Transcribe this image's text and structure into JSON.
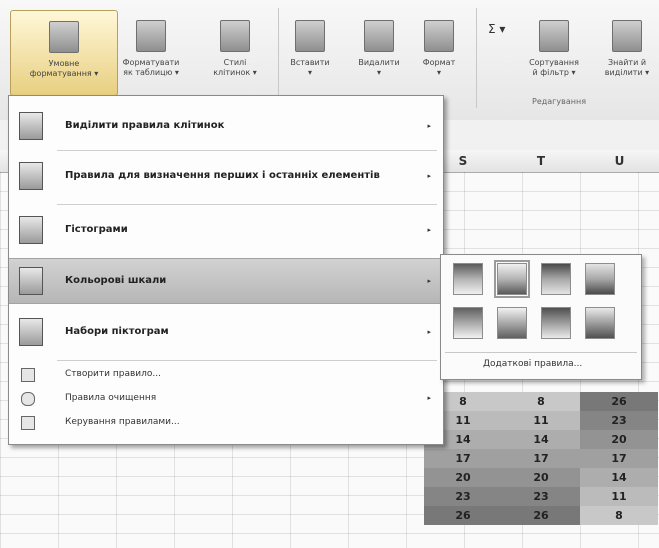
{
  "ribbon": {
    "buttons": [
      {
        "label": "Умовне\nформатування ▾"
      },
      {
        "label": "Форматувати\nяк таблицю ▾"
      },
      {
        "label": "Стилі\nклітинок ▾"
      },
      {
        "label": "Вставити\n▾"
      },
      {
        "label": "Видалити\n▾"
      },
      {
        "label": "Формат\n▾"
      },
      {
        "label": "Сортування\nй фільтр ▾"
      },
      {
        "label": "Знайти й\nвиділити ▾"
      }
    ],
    "editing_group": "Редагування",
    "sigma": "Σ ▾"
  },
  "sheet": {
    "columns": [
      "S",
      "T",
      "U"
    ],
    "rows": [
      [
        "8",
        "8",
        "26"
      ],
      [
        "11",
        "11",
        "23"
      ],
      [
        "14",
        "14",
        "20"
      ],
      [
        "17",
        "17",
        "17"
      ],
      [
        "20",
        "20",
        "14"
      ],
      [
        "23",
        "23",
        "11"
      ],
      [
        "26",
        "26",
        "8"
      ]
    ]
  },
  "menu": {
    "items": [
      {
        "label": "Виділити правила клітинок",
        "arrow": "▸"
      },
      {
        "label": "Правила для визначення перших і останніх елементів",
        "arrow": "▸"
      },
      {
        "label": "Гістограми",
        "arrow": "▸"
      },
      {
        "label": "Кольорові шкали",
        "arrow": "▸"
      },
      {
        "label": "Набори піктограм",
        "arrow": "▸"
      }
    ],
    "small_items": [
      {
        "label": "Створити правило...",
        "arrow": ""
      },
      {
        "label": "Правила очищення",
        "arrow": "▸"
      },
      {
        "label": "Керування правилами...",
        "arrow": ""
      }
    ]
  },
  "submenu": {
    "more_rules": "Додаткові правила..."
  }
}
